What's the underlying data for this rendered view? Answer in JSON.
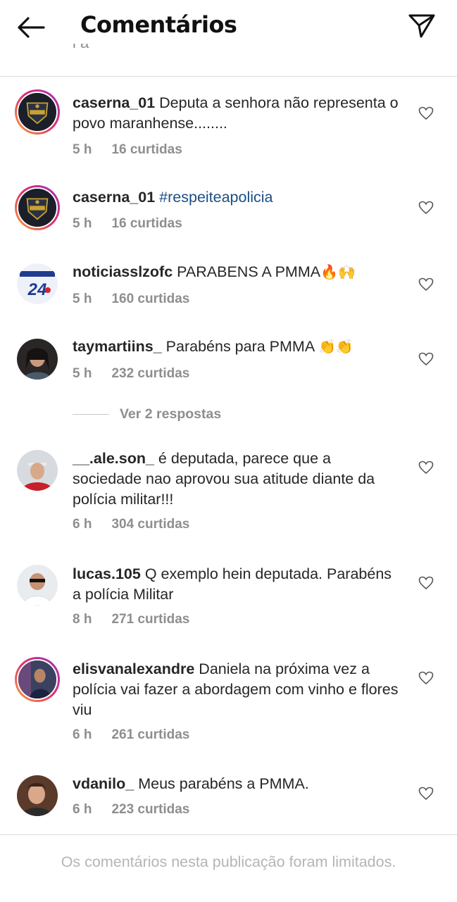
{
  "header": {
    "title": "Comentários",
    "back_icon": "arrow-left-icon",
    "send_icon": "paper-plane-icon"
  },
  "cut_text": "i a",
  "comments": [
    {
      "username": "caserna_01",
      "text": "Deputa a senhora não representa o povo maranhense........",
      "time": "5 h",
      "likes": "16 curtidas"
    },
    {
      "username": "caserna_01",
      "text": "",
      "hashtag": "#respeiteapolicia",
      "time": "5 h",
      "likes": "16 curtidas"
    },
    {
      "username": "noticiasslzofc",
      "text": "PARABENS A PMMA",
      "emoji": "🔥🙌",
      "time": "5 h",
      "likes": "160 curtidas"
    },
    {
      "username": "taymartiins_",
      "text": "Parabéns para PMMA",
      "emoji": "👏👏",
      "time": "5 h",
      "likes": "232 curtidas"
    },
    {
      "username": "__.ale.son_",
      "text": "é deputada, parece que a sociedade nao aprovou sua atitude diante da polícia militar!!!",
      "time": "6 h",
      "likes": "304 curtidas"
    },
    {
      "username": "lucas.105",
      "text": "Q exemplo hein deputada. Parabéns a polícia Militar",
      "time": "8 h",
      "likes": "271 curtidas"
    },
    {
      "username": "elisvanalexandre",
      "text": "Daniela na próxima vez a polícia vai fazer a abordagem com vinho e flores viu",
      "time": "6 h",
      "likes": "261 curtidas"
    },
    {
      "username": "vdanilo_",
      "text": "Meus parabéns a PMMA.",
      "time": "6 h",
      "likes": "223 curtidas"
    }
  ],
  "replies_label": "Ver 2 respostas",
  "footer": {
    "text": "Os comentários nesta publicação foram limitados."
  },
  "colors": {
    "accent_hashtag": "#1a4f85",
    "muted": "#8e8e8e",
    "divider": "#dbdbdb"
  }
}
